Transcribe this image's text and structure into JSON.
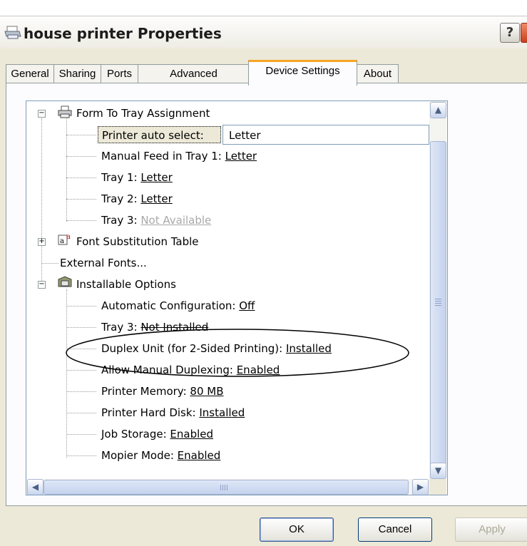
{
  "window": {
    "title": "house printer Properties",
    "help": "?"
  },
  "tabs": [
    {
      "label": "General"
    },
    {
      "label": "Sharing"
    },
    {
      "label": "Ports"
    },
    {
      "label": "Advanced"
    },
    {
      "label": "Device Settings"
    },
    {
      "label": "About"
    }
  ],
  "tree": {
    "form_to_tray": {
      "label": "Form To Tray Assignment",
      "edit_label": "Printer auto select:",
      "edit_value": "Letter",
      "manual_feed": {
        "label": "Manual Feed in Tray 1: ",
        "value": "Letter"
      },
      "tray1": {
        "label": "Tray 1: ",
        "value": "Letter"
      },
      "tray2": {
        "label": "Tray 2: ",
        "value": "Letter"
      },
      "tray3": {
        "label": "Tray 3: ",
        "value": "Not Available"
      }
    },
    "font_substitution": {
      "label": "Font Substitution Table"
    },
    "external_fonts": {
      "label": "External Fonts..."
    },
    "installable_options": {
      "label": "Installable Options",
      "auto_config": {
        "label": "Automatic Configuration: ",
        "value": "Off"
      },
      "tray3": {
        "label": "Tray 3: ",
        "value": "Not Installed"
      },
      "duplex": {
        "label": "Duplex Unit (for 2-Sided Printing): ",
        "value": "Installed"
      },
      "manual_duplex": {
        "label": "Allow Manual Duplexing: ",
        "value": "Enabled"
      },
      "memory": {
        "label": "Printer Memory: ",
        "value": "80 MB"
      },
      "hard_disk": {
        "label": "Printer Hard Disk: ",
        "value": "Installed"
      },
      "job_storage": {
        "label": "Job Storage: ",
        "value": "Enabled"
      },
      "mopier": {
        "label": "Mopier Mode: ",
        "value": "Enabled"
      }
    }
  },
  "buttons": {
    "ok": "OK",
    "cancel": "Cancel",
    "apply": "Apply"
  },
  "colors": {
    "accent_tab": "#f6a623",
    "border": "#919b9c",
    "window_bg": "#ece9d8"
  }
}
